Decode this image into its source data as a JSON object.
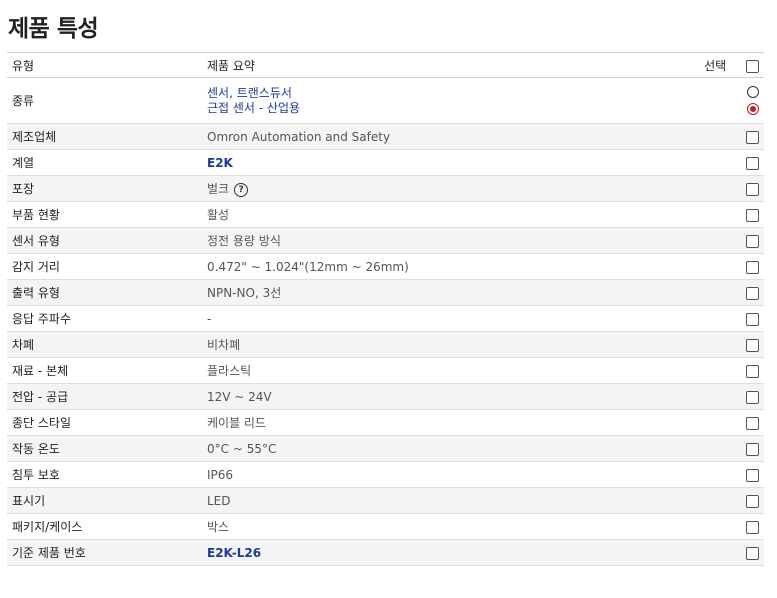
{
  "page": {
    "title": "제품 특성"
  },
  "table": {
    "headers": {
      "type": "유형",
      "summary": "제품 요약",
      "select": "선택"
    },
    "category_row": {
      "label": "종류",
      "values": [
        "센서, 트랜스듀서",
        "근접 센서 - 산업용"
      ],
      "selected_index": 1
    },
    "rows": [
      {
        "label": "제조업체",
        "value": "Omron Automation and Safety"
      },
      {
        "label": "계열",
        "value": "E2K"
      },
      {
        "label": "포장",
        "value": "벌크",
        "help_icon": "?"
      },
      {
        "label": "부품 현황",
        "value": "활성"
      },
      {
        "label": "센서 유형",
        "value": "정전 용량 방식"
      },
      {
        "label": "감지 거리",
        "value": "0.472\" ~ 1.024\"(12mm ~ 26mm)"
      },
      {
        "label": "출력 유형",
        "value": "NPN-NO, 3선"
      },
      {
        "label": "응답 주파수",
        "value": "-"
      },
      {
        "label": "차폐",
        "value": "비차폐"
      },
      {
        "label": "재료 - 본체",
        "value": "플라스틱"
      },
      {
        "label": "전압 - 공급",
        "value": "12V ~ 24V"
      },
      {
        "label": "종단 스타일",
        "value": "케이블 리드"
      },
      {
        "label": "작동 온도",
        "value": "0°C ~ 55°C"
      },
      {
        "label": "침투 보호",
        "value": "IP66"
      },
      {
        "label": "표시기",
        "value": "LED"
      },
      {
        "label": "패키지/케이스",
        "value": "박스"
      },
      {
        "label": "기준 제품 번호",
        "value": "E2K-L26"
      }
    ]
  },
  "colors": {
    "link": "#1a3a9c",
    "radio_selected": "#c02020"
  }
}
